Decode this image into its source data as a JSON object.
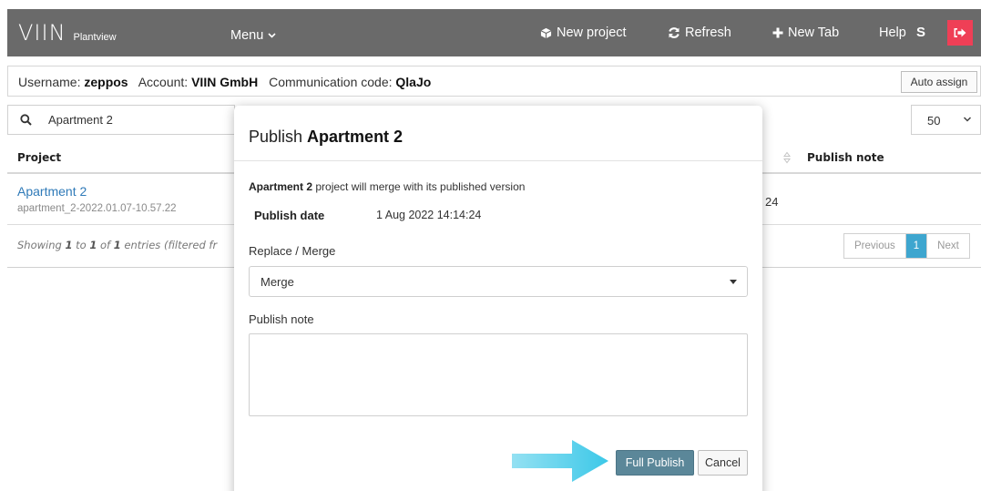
{
  "navbar": {
    "brand_logo": "VIIN",
    "brand_sub": "Plantview",
    "menu_label": "Menu",
    "new_project_label": "New project",
    "refresh_label": "Refresh",
    "new_tab_label": "New Tab",
    "help_label": "Help",
    "user_initial": "S",
    "icons": {
      "new_project": "cube-icon",
      "refresh": "refresh-icon",
      "new_tab": "plus-icon",
      "logout": "logout-icon",
      "menu": "chevron-down-icon"
    },
    "colors": {
      "bar": "#6a6a6a",
      "logout": "#ef3f56"
    }
  },
  "infobar": {
    "username_label": "Username:",
    "username": "zeppos",
    "account_label": "Account:",
    "account": "VIIN GmbH",
    "code_label": "Communication code:",
    "code": "QlaJo",
    "auto_assign_label": "Auto assign"
  },
  "search": {
    "value": "Apartment 2",
    "icon": "search-icon"
  },
  "page_size": {
    "value": "50"
  },
  "table": {
    "headers": {
      "project": "Project",
      "publish_note": "Publish note"
    },
    "rows": [
      {
        "title": "Apartment 2",
        "subtitle": "apartment_2-2022.01.07-10.57.22",
        "date_tail": "24"
      }
    ],
    "showing": {
      "prefix": "Showing ",
      "from": "1",
      "to_word": " to ",
      "to": "1",
      "of_word": " of ",
      "total": "1",
      "suffix": " entries (filtered fr"
    },
    "pager": {
      "previous": "Previous",
      "current": "1",
      "next": "Next",
      "active_color": "#3ea6cf"
    }
  },
  "modal": {
    "title_prefix": "Publish ",
    "title_name": "Apartment 2",
    "merge_name": "Apartment 2",
    "merge_text": " project will merge with its published version",
    "publish_date_label": "Publish date",
    "publish_date_value": "1 Aug 2022 14:14:24",
    "replace_merge_label": "Replace / Merge",
    "replace_merge_value": "Merge",
    "publish_note_label": "Publish note",
    "publish_note_value": "",
    "full_publish_label": "Full Publish",
    "cancel_label": "Cancel",
    "colors": {
      "full_publish": "#5b8799",
      "arrow": "#3cc8e8"
    }
  }
}
